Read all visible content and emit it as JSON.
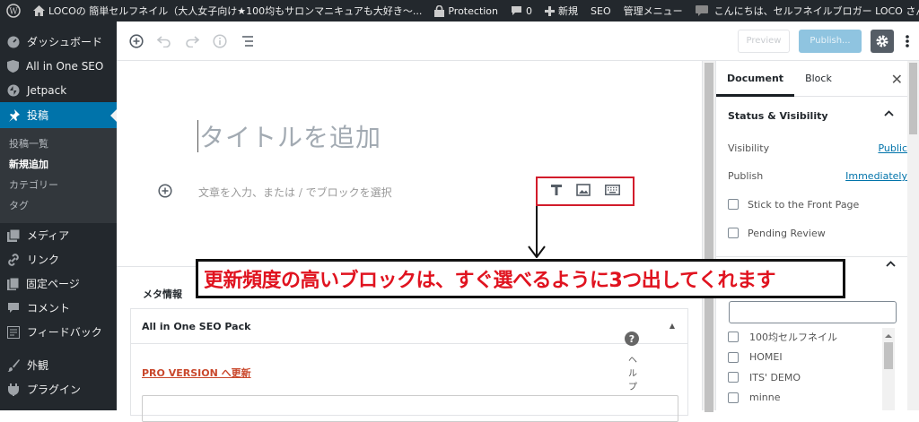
{
  "adminbar": {
    "site_name": "LOCOの 簡単セルフネイル（大人女子向け★100均もサロンマニキュアも大好き〜...",
    "protection": "Protection",
    "comments_count": "0",
    "new_label": "新規",
    "seo_label": "SEO",
    "manage_menu": "管理メニュー",
    "greeting": "こんにちは、セルフネイルブロガー LOCO さん"
  },
  "sidebar": {
    "items": [
      {
        "label": "ダッシュボード",
        "icon": "dashboard-icon"
      },
      {
        "label": "All in One SEO",
        "icon": "shield-icon"
      },
      {
        "label": "Jetpack",
        "icon": "jetpack-icon"
      },
      {
        "label": "投稿",
        "icon": "pin-icon"
      },
      {
        "label": "メディア",
        "icon": "media-icon"
      },
      {
        "label": "リンク",
        "icon": "link-icon"
      },
      {
        "label": "固定ページ",
        "icon": "page-icon"
      },
      {
        "label": "コメント",
        "icon": "comment-icon"
      },
      {
        "label": "フィードバック",
        "icon": "feedback-icon"
      },
      {
        "label": "外観",
        "icon": "brush-icon"
      },
      {
        "label": "プラグイン",
        "icon": "plugin-icon"
      }
    ],
    "submenu": [
      "投稿一覧",
      "新規追加",
      "カテゴリー",
      "タグ"
    ]
  },
  "toolbar": {
    "preview": "Preview",
    "publish": "Publish...",
    "preview_color": "#c9ccd0",
    "publish_color": "#8fc4e0"
  },
  "editor": {
    "title_placeholder": "タイトルを追加",
    "paragraph_placeholder": "文章を入力、または / でブロックを選択",
    "quick_inserter_border": "#d21c2b",
    "quick_blocks": [
      "heading-icon",
      "image-icon",
      "keyboard-icon"
    ]
  },
  "annotation": {
    "callout": "更新頻度の高いブロックは、すぐ選べるように3つ出してくれます",
    "color": "#e0131f"
  },
  "meta": {
    "title": "メタ情報",
    "box_title": "All in One SEO Pack",
    "pro_link": "PRO VERSION へ更新",
    "help_q": "?",
    "help_label": "ヘルプ"
  },
  "side": {
    "tab_document": "Document",
    "tab_block": "Block",
    "status_title": "Status & Visibility",
    "visibility_label": "Visibility",
    "visibility_value": "Public",
    "publish_label": "Publish",
    "publish_value": "Immediately",
    "stick_label": "Stick to the Front Page",
    "pending_label": "Pending Review",
    "categories": [
      "100均セルフネイル",
      "HOMEI",
      "ITS' DEMO",
      "minne"
    ]
  }
}
